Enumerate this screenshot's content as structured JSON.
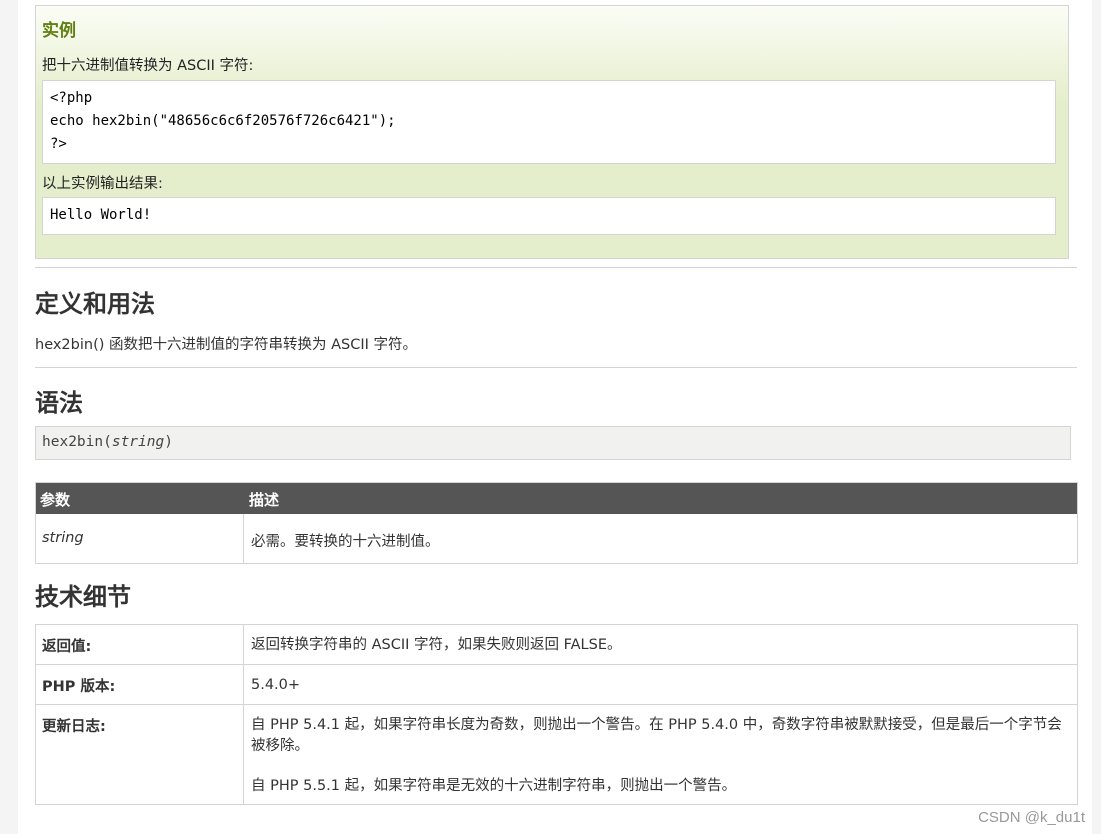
{
  "example": {
    "title": "实例",
    "description": "把十六进制值转换为 ASCII 字符:",
    "code_lines": [
      "<?php",
      "echo hex2bin(\"48656c6c6f20576f726c6421\");",
      "?>"
    ],
    "output_label": "以上实例输出结果:",
    "output": "Hello World!"
  },
  "definition": {
    "heading": "定义和用法",
    "text": "hex2bin() 函数把十六进制值的字符串转换为 ASCII 字符。"
  },
  "syntax": {
    "heading": "语法",
    "func": "hex2bin(",
    "param": "string",
    "close": ")"
  },
  "params_table": {
    "col1": "参数",
    "col2": "描述",
    "param_name": "string",
    "param_desc": "必需。要转换的十六进制值。"
  },
  "tech": {
    "heading": "技术细节",
    "rows": [
      {
        "label": "返回值:",
        "value": "返回转换字符串的 ASCII 字符，如果失败则返回 FALSE。"
      },
      {
        "label": "PHP 版本:",
        "value": "5.4.0+"
      },
      {
        "label": "更新日志:",
        "value": "自 PHP 5.4.1 起，如果字符串长度为奇数，则抛出一个警告。在 PHP 5.4.0 中，奇数字符串被默默接受，但是最后一个字节会被移除。",
        "value2": "自 PHP 5.5.1 起，如果字符串是无效的十六进制字符串，则抛出一个警告。"
      }
    ]
  },
  "watermark": "CSDN @k_du1t"
}
